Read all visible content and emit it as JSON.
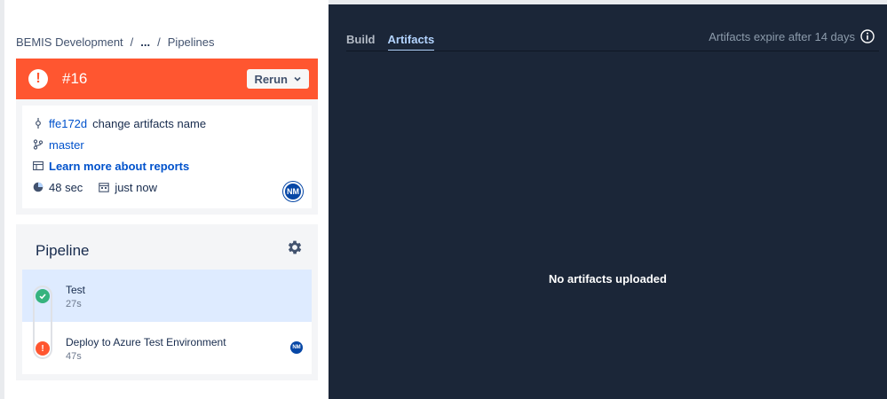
{
  "breadcrumb": {
    "project": "BEMIS Development",
    "sep1": "/",
    "ellipsis": "...",
    "sep2": "/",
    "current": "Pipelines"
  },
  "banner": {
    "status": "failed",
    "number": "#16",
    "rerun_label": "Rerun",
    "color": "#ff5630"
  },
  "commit": {
    "hash": "ffe172d",
    "message": "change artifacts name",
    "branch": "master",
    "reports_link": "Learn more about reports",
    "duration": "48 sec",
    "time": "just now",
    "user_initials": "NM"
  },
  "pipeline": {
    "title": "Pipeline",
    "steps": [
      {
        "name": "Test",
        "duration": "27s",
        "status": "success"
      },
      {
        "name": "Deploy to Azure Test Environment",
        "duration": "47s",
        "status": "failed",
        "user_initials": "NM"
      }
    ]
  },
  "panel": {
    "tabs": [
      "Build",
      "Artifacts"
    ],
    "selected_tab": "Artifacts",
    "expire_text": "Artifacts expire after 14 days",
    "empty_text": "No artifacts uploaded"
  }
}
